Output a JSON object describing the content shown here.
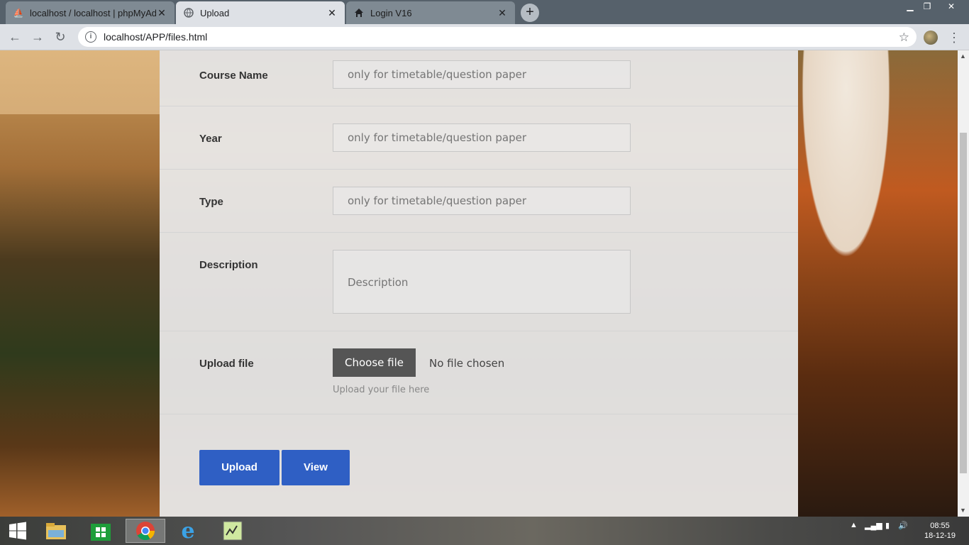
{
  "browser": {
    "tabs": [
      {
        "label": "localhost / localhost | phpMyAdmin",
        "icon": "phpmyadmin-icon",
        "active": false
      },
      {
        "label": "Upload",
        "icon": "globe-icon",
        "active": true
      },
      {
        "label": "Login V16",
        "icon": "home-icon",
        "active": false
      }
    ],
    "url": "localhost/APP/files.html"
  },
  "form": {
    "course_name": {
      "label": "Course Name",
      "placeholder": "only for timetable/question paper"
    },
    "year": {
      "label": "Year",
      "placeholder": "only for timetable/question paper"
    },
    "type": {
      "label": "Type",
      "placeholder": "only for timetable/question paper"
    },
    "description": {
      "label": "Description",
      "placeholder": "Description"
    },
    "upload": {
      "label": "Upload file",
      "choose_label": "Choose file",
      "status": "No file chosen",
      "hint": "Upload your file here"
    },
    "buttons": {
      "upload": "Upload",
      "view": "View"
    }
  },
  "taskbar": {
    "clock_time": "08:55",
    "clock_date": "18-12-19"
  },
  "colors": {
    "accent": "#2f5fc4",
    "choose_button": "#555555"
  }
}
